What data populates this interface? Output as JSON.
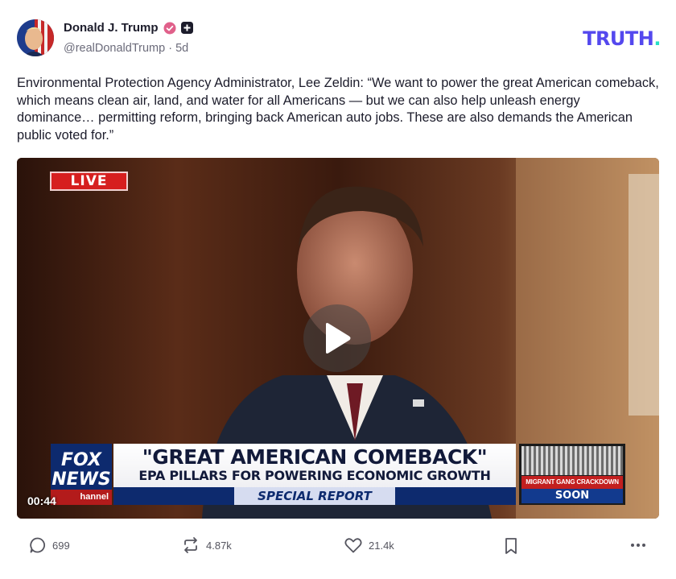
{
  "post": {
    "author_name": "Donald J. Trump",
    "handle": "@realDonaldTrump",
    "separator": "·",
    "time_ago": "5d",
    "text": "Environmental Protection Agency Administrator, Lee Zeldin: “We want to power the great American comeback, which means clean air, land, and water for all Americans — but we can also help unleash energy dominance… permitting reform, bringing back American auto jobs. These are also demands the American public voted for.”"
  },
  "brand": {
    "logo_text": "TRUTH",
    "logo_dot": ".",
    "logo_color": "#5448ee",
    "dot_color": "#27e0c6"
  },
  "video": {
    "duration": "00:44",
    "live_label": "LIVE",
    "fox_line1": "FOX",
    "fox_line2": "NEWS",
    "channel_tag": "hannel",
    "headline": "\"GREAT AMERICAN COMEBACK\"",
    "subheadline": "EPA PILLARS FOR POWERING ECONOMIC GROWTH",
    "segment": "SPECIAL REPORT",
    "side_red": "MIGRANT GANG CRACKDOWN",
    "side_blue": "SOON"
  },
  "actions": {
    "replies": "699",
    "retruths": "4.87k",
    "likes": "21.4k"
  },
  "icons": {
    "verified": "verified-badge-icon",
    "plus": "plus-badge-icon",
    "reply": "comment-icon",
    "retruth": "repost-icon",
    "like": "heart-icon",
    "bookmark": "bookmark-icon",
    "more": "more-icon",
    "play": "play-icon"
  }
}
